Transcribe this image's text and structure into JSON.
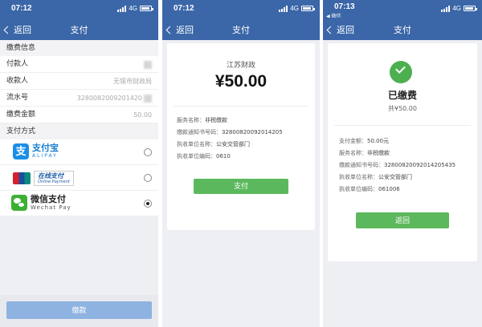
{
  "panel1": {
    "status": {
      "time": "07:12",
      "network": "4G"
    },
    "nav": {
      "back": "返回",
      "title": "支付"
    },
    "fee_info_header": "缴费信息",
    "rows": [
      {
        "label": "付款人",
        "value": ""
      },
      {
        "label": "收款人",
        "value": "无锡市财政局"
      },
      {
        "label": "流水号",
        "value": "3280082009201420"
      },
      {
        "label": "缴费金额",
        "value": "50.00"
      }
    ],
    "pay_method_header": "支付方式",
    "methods": [
      {
        "cn": "支付宝",
        "en": "ALIPAY",
        "selected": false
      },
      {
        "cn": "在线支付",
        "en": "Online Payment",
        "selected": false
      },
      {
        "cn": "微信支付",
        "en": "Wechat Pay",
        "selected": true
      }
    ],
    "pay_button": "缴款"
  },
  "panel2": {
    "status": {
      "time": "07:12",
      "network": "4G"
    },
    "nav": {
      "back": "返回",
      "title": "支付"
    },
    "org": "江苏财政",
    "amount": "¥50.00",
    "info": [
      {
        "label": "服务名称：",
        "value": "非税缴款"
      },
      {
        "label": "缴款通知书号码：",
        "value": "32800820092014205"
      },
      {
        "label": "执收单位名称：",
        "value": "公安交管部门"
      },
      {
        "label": "执收单位编码：",
        "value": "0610"
      }
    ],
    "pay_button": "支付"
  },
  "panel3": {
    "status": {
      "time": "07:13",
      "network": "4G",
      "back_app": "◀ 微信"
    },
    "nav": {
      "back": "返回",
      "title": "支付"
    },
    "paid_title": "已缴费",
    "paid_total": "共¥50.00",
    "info": [
      {
        "label": "支付金额：",
        "value": "50.00元"
      },
      {
        "label": "服务名称：",
        "value": "非税缴款"
      },
      {
        "label": "缴款通知书号码：",
        "value": "3280082009201420543​5"
      },
      {
        "label": "执收单位名称：",
        "value": "公安交管部门"
      },
      {
        "label": "执收单位编码：",
        "value": "061006"
      }
    ],
    "return_button": "返回"
  },
  "colors": {
    "nav_blue": "#3b66a8",
    "green": "#5cb85c",
    "pay_blue_disabled": "#8fb3e0"
  }
}
